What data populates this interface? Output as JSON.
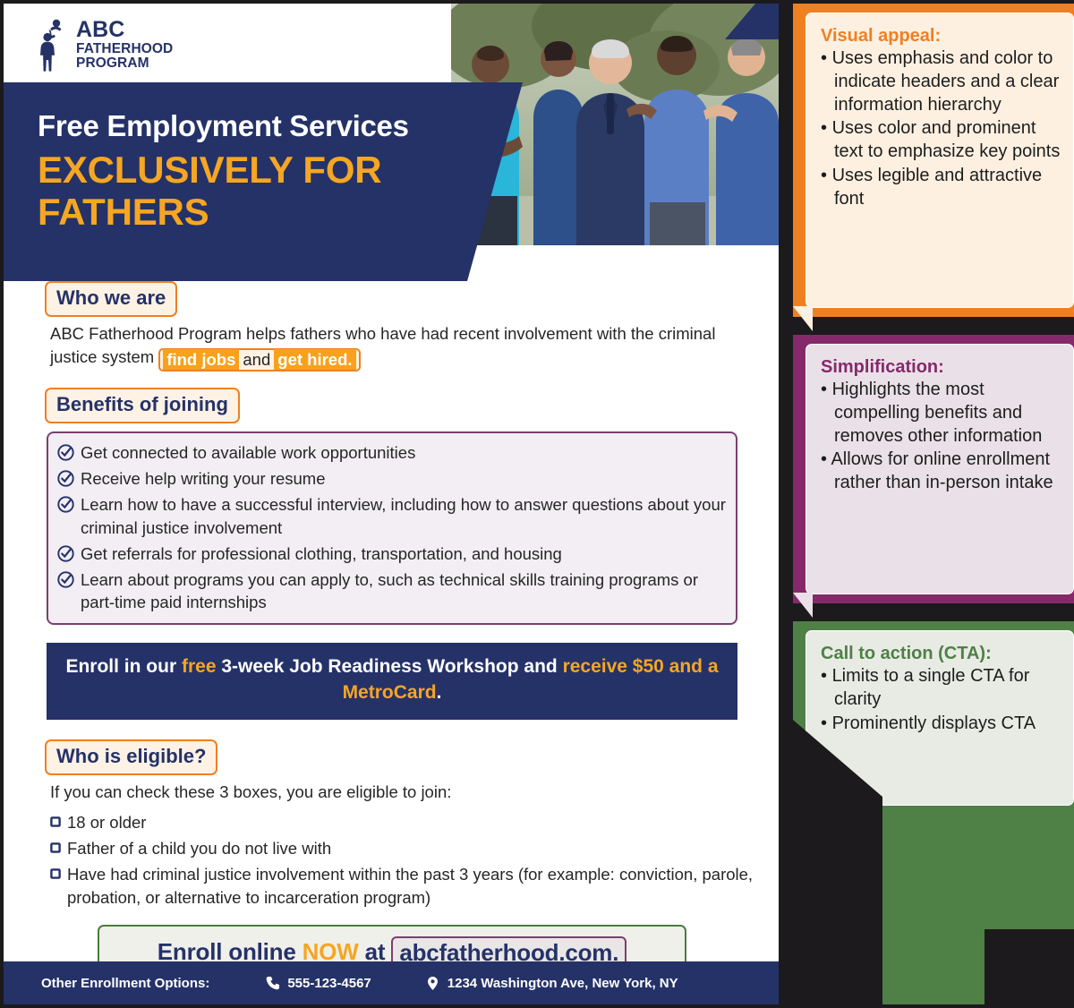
{
  "flyer": {
    "logo": {
      "icon": "father-lifting-child-icon",
      "line1": "ABC",
      "line2": "FATHERHOOD",
      "line3": "PROGRAM"
    },
    "photo_alt": "group-of-smiling-men-outdoors",
    "hero": {
      "line1": "Free Employment Services",
      "line2": "EXCLUSIVELY FOR FATHERS"
    },
    "who_we_are": {
      "heading": "Who we are",
      "text_before": "ABC Fatherhood Program helps fathers who have had recent involvement with the criminal justice system ",
      "highlight_1": "find jobs",
      "highlight_mid": "and",
      "highlight_2": "get hired."
    },
    "benefits": {
      "heading": "Benefits of joining",
      "icon": "circle-check-icon",
      "items": [
        "Get connected to available work opportunities",
        "Receive help writing your resume",
        "Learn how to have a successful interview, including how to answer questions about your criminal justice involvement",
        "Get referrals for professional clothing, transportation, and housing",
        "Learn about programs you can apply to, such as technical skills training programs or part-time paid internships"
      ]
    },
    "workshop_banner": {
      "part1": "Enroll in our ",
      "free": "free",
      "part2": " 3-week Job Readiness Workshop and ",
      "part3": "receive $50 and a MetroCard",
      "period": "."
    },
    "eligibility": {
      "heading": "Who is eligible?",
      "intro": "If you can check these 3 boxes, you are eligible to join:",
      "icon": "empty-checkbox-icon",
      "items": [
        "18 or older",
        "Father of a child you do not live with",
        "Have had criminal justice involvement within the past 3 years (for example: conviction, parole, probation, or alternative to incarceration program)"
      ]
    },
    "cta": {
      "part1": "Enroll online ",
      "now": "NOW",
      "part2": " at ",
      "url": "abcfatherhood.com."
    },
    "footer": {
      "label": "Other Enrollment Options:",
      "phone_icon": "phone-icon",
      "phone": "555-123-4567",
      "location_icon": "map-pin-icon",
      "address": "1234 Washington Ave, New York, NY"
    }
  },
  "annotations": [
    {
      "id": "visual-appeal",
      "title": "Visual appeal:",
      "accent": "#ef8022",
      "bullets": [
        "Uses emphasis and color to indicate headers and a clear information hierarchy",
        "Uses color and prominent text to emphasize key points",
        "Uses legible and attractive font"
      ]
    },
    {
      "id": "simplification",
      "title": "Simplification:",
      "accent": "#86296b",
      "bullets": [
        "Highlights the most compelling benefits and removes other information",
        "Allows for online enrollment rather than in-person intake"
      ]
    },
    {
      "id": "call-to-action",
      "title": "Call to action (CTA):",
      "accent": "#4f8046",
      "bullets": [
        "Limits to a single CTA for clarity",
        "Prominently displays CTA"
      ]
    }
  ],
  "colors": {
    "navy": "#253268",
    "gold": "#f5a623",
    "orange": "#ef8022",
    "purple": "#86296b",
    "green": "#4f8046"
  }
}
